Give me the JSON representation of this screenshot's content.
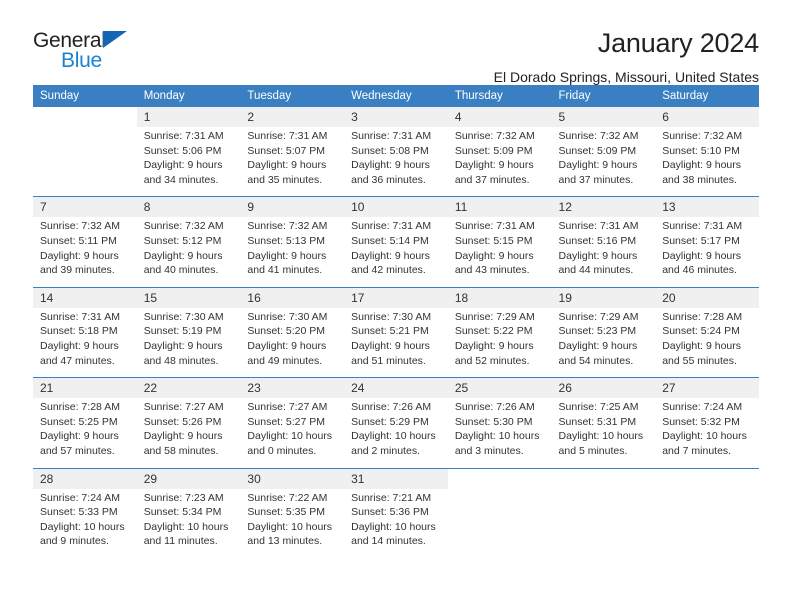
{
  "logo": {
    "word_one": "General",
    "word_two": "Blue",
    "triangle_icon": "blue-triangle-icon",
    "accent_dark": "#231f20",
    "accent_blue": "#1b82d2",
    "triangle_blue": "#1266b5"
  },
  "header": {
    "title": "January 2024",
    "subtitle": "El Dorado Springs, Missouri, United States"
  },
  "calendar": {
    "header_bg": "#3a7fc1",
    "daynum_bg": "#f0f0f0",
    "weekdays": [
      "Sunday",
      "Monday",
      "Tuesday",
      "Wednesday",
      "Thursday",
      "Friday",
      "Saturday"
    ],
    "weeks": [
      [
        {
          "day": "",
          "lines": []
        },
        {
          "day": "1",
          "lines": [
            "Sunrise: 7:31 AM",
            "Sunset: 5:06 PM",
            "Daylight: 9 hours",
            "and 34 minutes."
          ]
        },
        {
          "day": "2",
          "lines": [
            "Sunrise: 7:31 AM",
            "Sunset: 5:07 PM",
            "Daylight: 9 hours",
            "and 35 minutes."
          ]
        },
        {
          "day": "3",
          "lines": [
            "Sunrise: 7:31 AM",
            "Sunset: 5:08 PM",
            "Daylight: 9 hours",
            "and 36 minutes."
          ]
        },
        {
          "day": "4",
          "lines": [
            "Sunrise: 7:32 AM",
            "Sunset: 5:09 PM",
            "Daylight: 9 hours",
            "and 37 minutes."
          ]
        },
        {
          "day": "5",
          "lines": [
            "Sunrise: 7:32 AM",
            "Sunset: 5:09 PM",
            "Daylight: 9 hours",
            "and 37 minutes."
          ]
        },
        {
          "day": "6",
          "lines": [
            "Sunrise: 7:32 AM",
            "Sunset: 5:10 PM",
            "Daylight: 9 hours",
            "and 38 minutes."
          ]
        }
      ],
      [
        {
          "day": "7",
          "lines": [
            "Sunrise: 7:32 AM",
            "Sunset: 5:11 PM",
            "Daylight: 9 hours",
            "and 39 minutes."
          ]
        },
        {
          "day": "8",
          "lines": [
            "Sunrise: 7:32 AM",
            "Sunset: 5:12 PM",
            "Daylight: 9 hours",
            "and 40 minutes."
          ]
        },
        {
          "day": "9",
          "lines": [
            "Sunrise: 7:32 AM",
            "Sunset: 5:13 PM",
            "Daylight: 9 hours",
            "and 41 minutes."
          ]
        },
        {
          "day": "10",
          "lines": [
            "Sunrise: 7:31 AM",
            "Sunset: 5:14 PM",
            "Daylight: 9 hours",
            "and 42 minutes."
          ]
        },
        {
          "day": "11",
          "lines": [
            "Sunrise: 7:31 AM",
            "Sunset: 5:15 PM",
            "Daylight: 9 hours",
            "and 43 minutes."
          ]
        },
        {
          "day": "12",
          "lines": [
            "Sunrise: 7:31 AM",
            "Sunset: 5:16 PM",
            "Daylight: 9 hours",
            "and 44 minutes."
          ]
        },
        {
          "day": "13",
          "lines": [
            "Sunrise: 7:31 AM",
            "Sunset: 5:17 PM",
            "Daylight: 9 hours",
            "and 46 minutes."
          ]
        }
      ],
      [
        {
          "day": "14",
          "lines": [
            "Sunrise: 7:31 AM",
            "Sunset: 5:18 PM",
            "Daylight: 9 hours",
            "and 47 minutes."
          ]
        },
        {
          "day": "15",
          "lines": [
            "Sunrise: 7:30 AM",
            "Sunset: 5:19 PM",
            "Daylight: 9 hours",
            "and 48 minutes."
          ]
        },
        {
          "day": "16",
          "lines": [
            "Sunrise: 7:30 AM",
            "Sunset: 5:20 PM",
            "Daylight: 9 hours",
            "and 49 minutes."
          ]
        },
        {
          "day": "17",
          "lines": [
            "Sunrise: 7:30 AM",
            "Sunset: 5:21 PM",
            "Daylight: 9 hours",
            "and 51 minutes."
          ]
        },
        {
          "day": "18",
          "lines": [
            "Sunrise: 7:29 AM",
            "Sunset: 5:22 PM",
            "Daylight: 9 hours",
            "and 52 minutes."
          ]
        },
        {
          "day": "19",
          "lines": [
            "Sunrise: 7:29 AM",
            "Sunset: 5:23 PM",
            "Daylight: 9 hours",
            "and 54 minutes."
          ]
        },
        {
          "day": "20",
          "lines": [
            "Sunrise: 7:28 AM",
            "Sunset: 5:24 PM",
            "Daylight: 9 hours",
            "and 55 minutes."
          ]
        }
      ],
      [
        {
          "day": "21",
          "lines": [
            "Sunrise: 7:28 AM",
            "Sunset: 5:25 PM",
            "Daylight: 9 hours",
            "and 57 minutes."
          ]
        },
        {
          "day": "22",
          "lines": [
            "Sunrise: 7:27 AM",
            "Sunset: 5:26 PM",
            "Daylight: 9 hours",
            "and 58 minutes."
          ]
        },
        {
          "day": "23",
          "lines": [
            "Sunrise: 7:27 AM",
            "Sunset: 5:27 PM",
            "Daylight: 10 hours",
            "and 0 minutes."
          ]
        },
        {
          "day": "24",
          "lines": [
            "Sunrise: 7:26 AM",
            "Sunset: 5:29 PM",
            "Daylight: 10 hours",
            "and 2 minutes."
          ]
        },
        {
          "day": "25",
          "lines": [
            "Sunrise: 7:26 AM",
            "Sunset: 5:30 PM",
            "Daylight: 10 hours",
            "and 3 minutes."
          ]
        },
        {
          "day": "26",
          "lines": [
            "Sunrise: 7:25 AM",
            "Sunset: 5:31 PM",
            "Daylight: 10 hours",
            "and 5 minutes."
          ]
        },
        {
          "day": "27",
          "lines": [
            "Sunrise: 7:24 AM",
            "Sunset: 5:32 PM",
            "Daylight: 10 hours",
            "and 7 minutes."
          ]
        }
      ],
      [
        {
          "day": "28",
          "lines": [
            "Sunrise: 7:24 AM",
            "Sunset: 5:33 PM",
            "Daylight: 10 hours",
            "and 9 minutes."
          ]
        },
        {
          "day": "29",
          "lines": [
            "Sunrise: 7:23 AM",
            "Sunset: 5:34 PM",
            "Daylight: 10 hours",
            "and 11 minutes."
          ]
        },
        {
          "day": "30",
          "lines": [
            "Sunrise: 7:22 AM",
            "Sunset: 5:35 PM",
            "Daylight: 10 hours",
            "and 13 minutes."
          ]
        },
        {
          "day": "31",
          "lines": [
            "Sunrise: 7:21 AM",
            "Sunset: 5:36 PM",
            "Daylight: 10 hours",
            "and 14 minutes."
          ]
        },
        {
          "day": "",
          "lines": []
        },
        {
          "day": "",
          "lines": []
        },
        {
          "day": "",
          "lines": []
        }
      ]
    ]
  }
}
